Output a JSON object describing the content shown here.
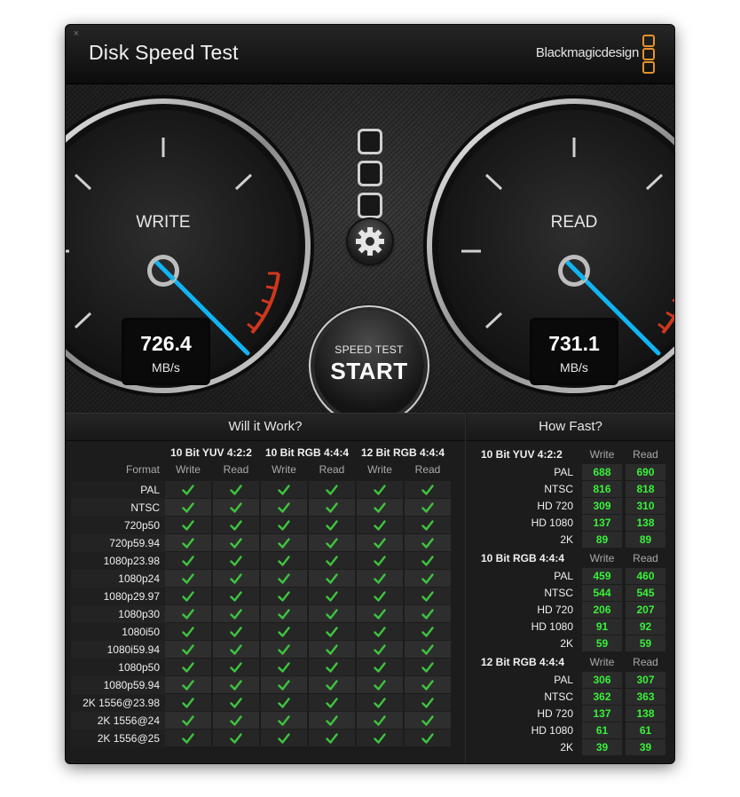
{
  "app": {
    "title": "Disk Speed Test",
    "brand": "Blackmagicdesign"
  },
  "gauges": {
    "write": {
      "label": "WRITE",
      "value": "726.4",
      "unit": "MB/s"
    },
    "read": {
      "label": "READ",
      "value": "731.1",
      "unit": "MB/s"
    }
  },
  "start_button": {
    "small": "SPEED TEST",
    "big": "START"
  },
  "will_it_work": {
    "title": "Will it Work?",
    "format_header": "Format",
    "groups": [
      "10 Bit YUV 4:2:2",
      "10 Bit RGB 4:4:4",
      "12 Bit RGB 4:4:4"
    ],
    "subcols": [
      "Write",
      "Read"
    ],
    "formats": [
      "PAL",
      "NTSC",
      "720p50",
      "720p59.94",
      "1080p23.98",
      "1080p24",
      "1080p29.97",
      "1080p30",
      "1080i50",
      "1080i59.94",
      "1080p50",
      "1080p59.94",
      "2K 1556@23.98",
      "2K 1556@24",
      "2K 1556@25"
    ],
    "check_color": "#3ec43e"
  },
  "how_fast": {
    "title": "How Fast?",
    "write_label": "Write",
    "read_label": "Read",
    "groups": [
      {
        "name": "10 Bit YUV 4:2:2",
        "rows": [
          {
            "label": "PAL",
            "write": "688",
            "read": "690"
          },
          {
            "label": "NTSC",
            "write": "816",
            "read": "818"
          },
          {
            "label": "HD 720",
            "write": "309",
            "read": "310"
          },
          {
            "label": "HD 1080",
            "write": "137",
            "read": "138"
          },
          {
            "label": "2K",
            "write": "89",
            "read": "89"
          }
        ]
      },
      {
        "name": "10 Bit RGB 4:4:4",
        "rows": [
          {
            "label": "PAL",
            "write": "459",
            "read": "460"
          },
          {
            "label": "NTSC",
            "write": "544",
            "read": "545"
          },
          {
            "label": "HD 720",
            "write": "206",
            "read": "207"
          },
          {
            "label": "HD 1080",
            "write": "91",
            "read": "92"
          },
          {
            "label": "2K",
            "write": "59",
            "read": "59"
          }
        ]
      },
      {
        "name": "12 Bit RGB 4:4:4",
        "rows": [
          {
            "label": "PAL",
            "write": "306",
            "read": "307"
          },
          {
            "label": "NTSC",
            "write": "362",
            "read": "363"
          },
          {
            "label": "HD 720",
            "write": "137",
            "read": "138"
          },
          {
            "label": "HD 1080",
            "write": "61",
            "read": "61"
          },
          {
            "label": "2K",
            "write": "39",
            "read": "39"
          }
        ]
      }
    ],
    "value_color": "#39f03a"
  }
}
